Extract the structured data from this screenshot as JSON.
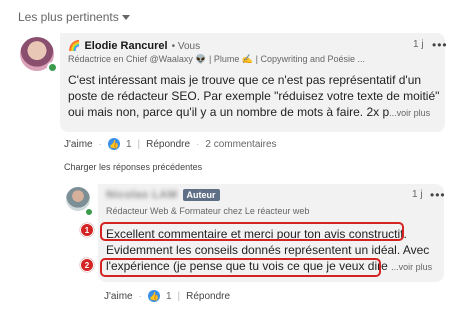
{
  "sort": {
    "label": "Les plus pertinents"
  },
  "comment1": {
    "emoji": "🌈",
    "author": "Elodie Rancurel",
    "degree": "• Vous",
    "headline": "Rédactrice en Chief @Waalaxy 👽 | Plume ✍️ | Copywriting and Poésie ...",
    "time": "1 j",
    "more": "•••",
    "text": "C'est intéressant mais je trouve que ce n'est pas représentatif d'un poste de  rédacteur SEO. Par exemple \"réduisez votre texte de moitié\" oui mais non, parce qu'il y a un nombre de mots à faire. 2x p",
    "see_more": "...voir plus",
    "like_label": "J'aime",
    "like_count": "1",
    "reply_label": "Répondre",
    "comments_count": "2 commentaires"
  },
  "load_previous": "Charger les réponses précédentes",
  "reply1": {
    "author": "Nicolas LAM",
    "author_badge": "Auteur",
    "headline": "Rédacteur Web & Formateur chez Le réacteur web",
    "time": "1 j",
    "more": "•••",
    "line1": "Excellent commentaire et merci pour ton avis constructif.",
    "line2": "Evidemment les conseils donnés représentent un idéal. Avec",
    "line3": "l'expérience (je pense que tu vois ce que je veux dire",
    "see_more": "...voir plus",
    "like_label": "J'aime",
    "like_count": "1",
    "reply_label": "Répondre"
  },
  "markers": [
    "1",
    "2"
  ],
  "colors": {
    "highlight": "#d42323",
    "like": "#378fe9",
    "badge": "#5f6f85"
  }
}
